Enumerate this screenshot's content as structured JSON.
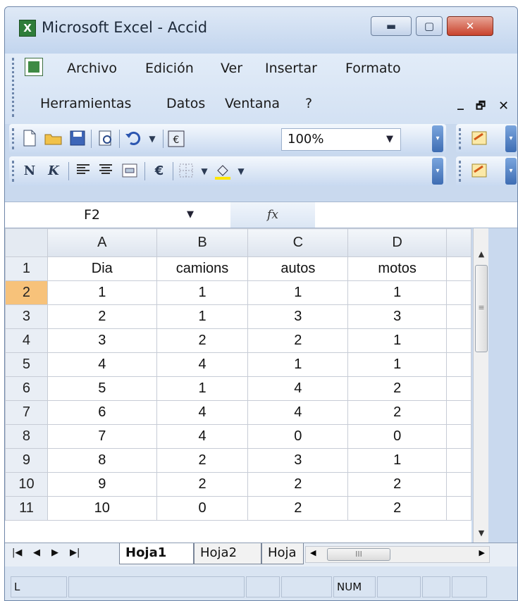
{
  "window": {
    "title": "Microsoft Excel - Accid",
    "controls": {
      "minimize": "▬",
      "maximize": "▢",
      "close": "✕"
    }
  },
  "menu": {
    "items": [
      "Archivo",
      "Edición",
      "Ver",
      "Insertar",
      "Formato",
      "Herramientas",
      "Datos",
      "Ventana",
      "?"
    ],
    "mdi_minimize": "_",
    "mdi_restore": "🗗",
    "mdi_close": "✕"
  },
  "toolbar_standard": {
    "zoom_value": "100%"
  },
  "toolbar_format": {
    "bold_label": "N",
    "italic_label": "K",
    "euro_label": "€"
  },
  "formula_bar": {
    "name_box": "F2",
    "fx_label": "fx"
  },
  "sheet": {
    "column_headers": [
      "A",
      "B",
      "C",
      "D",
      ""
    ],
    "row_headers": [
      "1",
      "2",
      "3",
      "4",
      "5",
      "6",
      "7",
      "8",
      "9",
      "10",
      "11"
    ],
    "active_row": "2",
    "rows": [
      [
        "Dia",
        "camions",
        "autos",
        "motos",
        ""
      ],
      [
        "1",
        "1",
        "1",
        "1",
        ""
      ],
      [
        "2",
        "1",
        "3",
        "3",
        ""
      ],
      [
        "3",
        "2",
        "2",
        "1",
        ""
      ],
      [
        "4",
        "4",
        "1",
        "1",
        ""
      ],
      [
        "5",
        "1",
        "4",
        "2",
        ""
      ],
      [
        "6",
        "4",
        "4",
        "2",
        ""
      ],
      [
        "7",
        "4",
        "0",
        "0",
        ""
      ],
      [
        "8",
        "2",
        "3",
        "1",
        ""
      ],
      [
        "9",
        "2",
        "2",
        "2",
        ""
      ],
      [
        "10",
        "0",
        "2",
        "2",
        ""
      ]
    ]
  },
  "tabs": {
    "sheets": [
      "Hoja1",
      "Hoja2",
      "Hoja"
    ],
    "active": "Hoja1"
  },
  "status": {
    "mode": "L",
    "num": "NUM"
  },
  "colors": {
    "active_row_header": "#f7c27a",
    "window_chrome": "#c9d9ee",
    "close_button": "#c8422c"
  }
}
